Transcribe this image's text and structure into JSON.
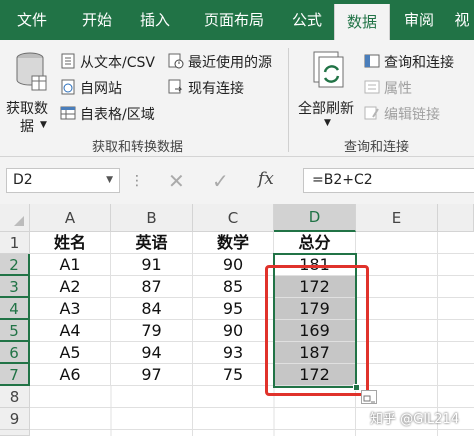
{
  "tabs": [
    "文件",
    "开始",
    "插入",
    "页面布局",
    "公式",
    "数据",
    "审阅",
    "视"
  ],
  "ribbon": {
    "get_data": [
      "获取数",
      "据"
    ],
    "from_text_csv": "从文本/CSV",
    "from_web": "自网站",
    "from_table": "自表格/区域",
    "recent_sources": "最近使用的源",
    "existing_connections": "现有连接",
    "group1_label": "获取和转换数据",
    "refresh_all": "全部刷新",
    "queries_connections": "查询和连接",
    "properties": "属性",
    "edit_links": "编辑链接",
    "group2_label": "查询和连接"
  },
  "formula_bar": {
    "name_box": "D2",
    "fx": "fx",
    "formula": "=B2+C2"
  },
  "columns": [
    "A",
    "B",
    "C",
    "D",
    "E"
  ],
  "rows": [
    "1",
    "2",
    "3",
    "4",
    "5",
    "6",
    "7",
    "8",
    "9",
    "10"
  ],
  "cells": [
    [
      "姓名",
      "英语",
      "数学",
      "总分"
    ],
    [
      "A1",
      "91",
      "90",
      "181"
    ],
    [
      "A2",
      "87",
      "85",
      "172"
    ],
    [
      "A3",
      "84",
      "95",
      "179"
    ],
    [
      "A4",
      "79",
      "90",
      "169"
    ],
    [
      "A5",
      "94",
      "93",
      "187"
    ],
    [
      "A6",
      "97",
      "75",
      "172"
    ]
  ],
  "watermark": "知乎 @GIL214",
  "colors": {
    "excel_green": "#217346",
    "highlight_red": "#e0322b"
  }
}
